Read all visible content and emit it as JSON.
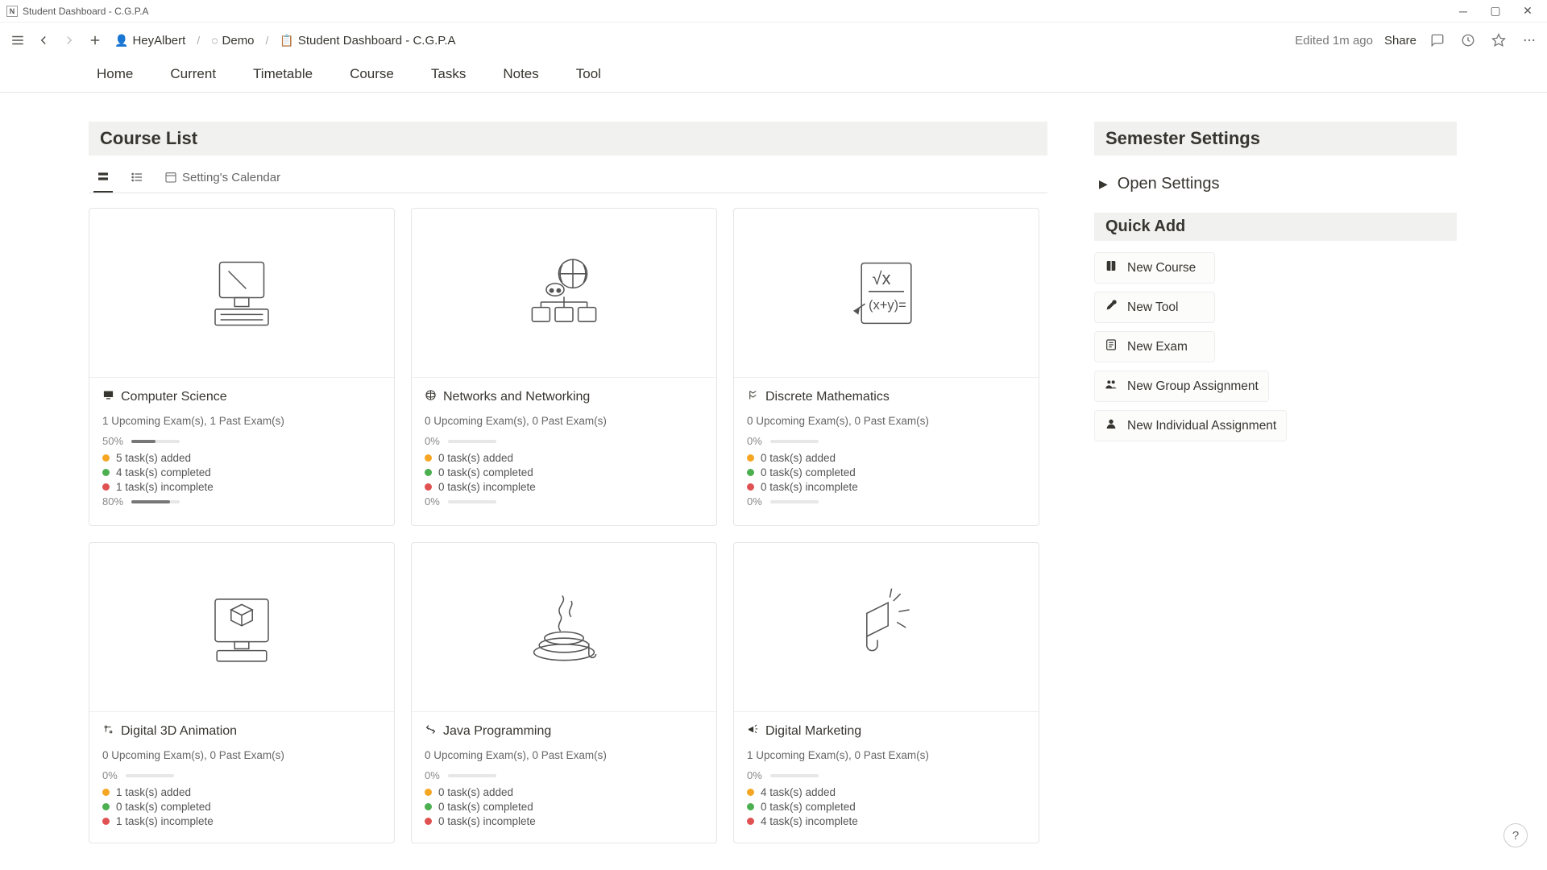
{
  "window": {
    "title": "Student Dashboard - C.G.P.A"
  },
  "topbar": {
    "edited": "Edited 1m ago",
    "share": "Share",
    "crumbs": [
      {
        "label": "HeyAlbert"
      },
      {
        "label": "Demo"
      },
      {
        "label": "Student Dashboard - C.G.P.A"
      }
    ]
  },
  "page_tabs": [
    "Home",
    "Current",
    "Timetable",
    "Course",
    "Tasks",
    "Notes",
    "Tool"
  ],
  "course_list": {
    "title": "Course List",
    "view_calendar": "Setting's Calendar"
  },
  "courses": [
    {
      "name": "Computer Science",
      "exams": "1 Upcoming Exam(s), 1 Past Exam(s)",
      "p1_label": "50%",
      "p1_val": 50,
      "added": "5 task(s) added",
      "completed": "4 task(s) completed",
      "incomplete": "1 task(s) incomplete",
      "p2_label": "80%",
      "p2_val": 80
    },
    {
      "name": "Networks and Networking",
      "exams": "0 Upcoming Exam(s), 0 Past Exam(s)",
      "p1_label": "0%",
      "p1_val": 0,
      "added": "0 task(s) added",
      "completed": "0 task(s) completed",
      "incomplete": "0 task(s) incomplete",
      "p2_label": "0%",
      "p2_val": 0
    },
    {
      "name": "Discrete Mathematics",
      "exams": "0 Upcoming Exam(s), 0 Past Exam(s)",
      "p1_label": "0%",
      "p1_val": 0,
      "added": "0 task(s) added",
      "completed": "0 task(s) completed",
      "incomplete": "0 task(s) incomplete",
      "p2_label": "0%",
      "p2_val": 0
    },
    {
      "name": "Digital 3D Animation",
      "exams": "0 Upcoming Exam(s), 0 Past Exam(s)",
      "p1_label": "0%",
      "p1_val": 0,
      "added": "1 task(s) added",
      "completed": "0 task(s) completed",
      "incomplete": "1 task(s) incomplete",
      "p2_label": "",
      "p2_val": 0
    },
    {
      "name": "Java Programming",
      "exams": "0 Upcoming Exam(s), 0 Past Exam(s)",
      "p1_label": "0%",
      "p1_val": 0,
      "added": "0 task(s) added",
      "completed": "0 task(s) completed",
      "incomplete": "0 task(s) incomplete",
      "p2_label": "",
      "p2_val": 0
    },
    {
      "name": "Digital Marketing",
      "exams": "1 Upcoming Exam(s), 0 Past Exam(s)",
      "p1_label": "0%",
      "p1_val": 0,
      "added": "4 task(s) added",
      "completed": "0 task(s) completed",
      "incomplete": "4 task(s) incomplete",
      "p2_label": "",
      "p2_val": 0
    }
  ],
  "semester": {
    "title": "Semester Settings",
    "open": "Open Settings"
  },
  "quick": {
    "title": "Quick Add",
    "items": [
      "New Course",
      "New Tool",
      "New Exam",
      "New Group Assignment",
      "New Individual Assignment"
    ]
  },
  "help": "?"
}
